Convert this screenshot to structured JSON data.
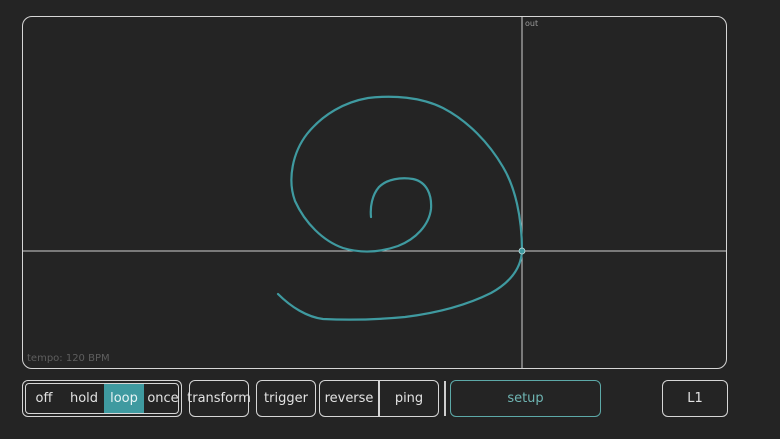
{
  "stage": {
    "out_label": "out",
    "tempo_label": "tempo: 120 BPM",
    "accent_color": "#3f9aa0"
  },
  "toolbar": {
    "modes": [
      {
        "label": "off",
        "active": false
      },
      {
        "label": "hold",
        "active": false
      },
      {
        "label": "loop",
        "active": true
      },
      {
        "label": "once",
        "active": false
      }
    ],
    "transform_label": "transform",
    "trigger_label": "trigger",
    "reverse_label": "reverse",
    "ping_label": "ping",
    "setup_label": "setup",
    "layer_label": "L1"
  }
}
